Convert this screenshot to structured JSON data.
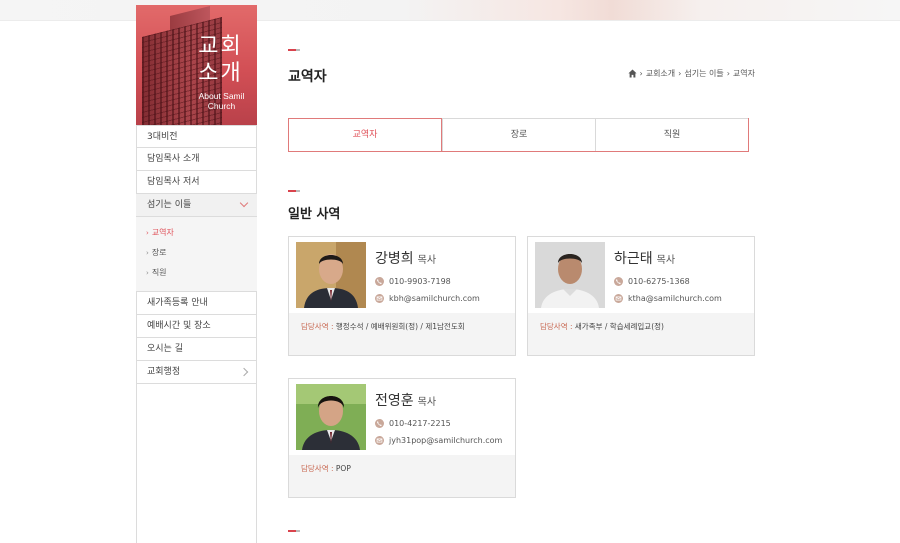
{
  "sidebar": {
    "hero_title_line1": "교회",
    "hero_title_line2": "소개",
    "hero_subtitle": "About Samil Church",
    "items": [
      {
        "label": "3대비전"
      },
      {
        "label": "담임목사 소개"
      },
      {
        "label": "담임목사 저서"
      },
      {
        "label": "섬기는 이들"
      }
    ],
    "submenu": [
      {
        "label": "교역자"
      },
      {
        "label": "장로"
      },
      {
        "label": "직원"
      }
    ],
    "items_after": [
      {
        "label": "새가족등록 안내"
      },
      {
        "label": "예배시간 및 장소"
      },
      {
        "label": "오시는 길"
      },
      {
        "label": "교회행정"
      }
    ]
  },
  "page": {
    "title": "교역자",
    "section_title": "일반 사역"
  },
  "breadcrumb": [
    "교회소개",
    "섬기는 이들",
    "교역자"
  ],
  "tabs": [
    {
      "label": "교역자"
    },
    {
      "label": "장로"
    },
    {
      "label": "직원"
    }
  ],
  "staff": [
    {
      "name": "강병희",
      "role": "목사",
      "phone": "010-9903-7198",
      "email": "kbh@samilchurch.com",
      "duty_label": "담당사역 :",
      "duty": "행정수석 / 예배위원회(정) / 제1남전도회"
    },
    {
      "name": "하근태",
      "role": "목사",
      "phone": "010-6275-1368",
      "email": "ktha@samilchurch.com",
      "duty_label": "담당사역 :",
      "duty": "새가족부 / 학습세례입교(정)"
    },
    {
      "name": "전영훈",
      "role": "목사",
      "phone": "010-4217-2215",
      "email": "jyh31pop@samilchurch.com",
      "duty_label": "담당사역 :",
      "duty": "POP"
    }
  ],
  "colors": {
    "accent": "#e0525a",
    "tab_border": "#e07a7a",
    "icon_bg": "#c9a89a",
    "hero_bg": "#d24f55"
  }
}
